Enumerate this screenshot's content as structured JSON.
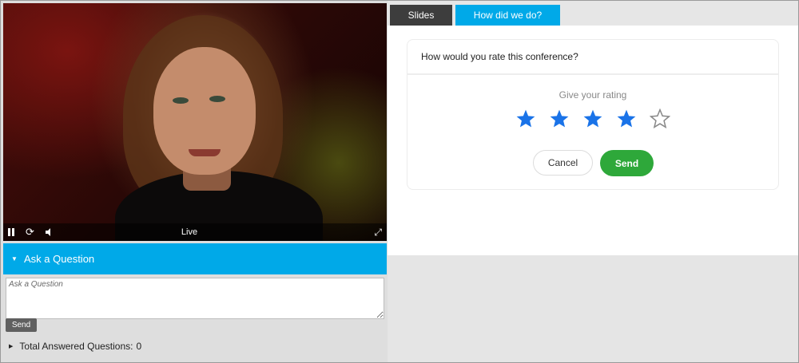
{
  "video": {
    "status_text": "Live",
    "controls": {
      "pause_icon": "pause-icon",
      "refresh_icon": "refresh-icon",
      "volume_icon": "volume-icon",
      "fullscreen_icon": "fullscreen-icon"
    }
  },
  "ask": {
    "header_label": "Ask a Question",
    "placeholder": "Ask a Question",
    "send_label": "Send",
    "total_label": "Total Answered Questions:",
    "total_count": "0"
  },
  "tabs": [
    {
      "label": "Slides",
      "active": false
    },
    {
      "label": "How did we do?",
      "active": true
    }
  ],
  "rating": {
    "question": "How would you rate this conference?",
    "prompt": "Give your rating",
    "value": 4,
    "max": 5,
    "cancel_label": "Cancel",
    "send_label": "Send"
  },
  "colors": {
    "accent": "#00a9e8",
    "star_filled": "#1a73e8",
    "star_empty": "#888888",
    "send_green": "#2ea83a",
    "tab_dark": "#3d3d3d"
  }
}
